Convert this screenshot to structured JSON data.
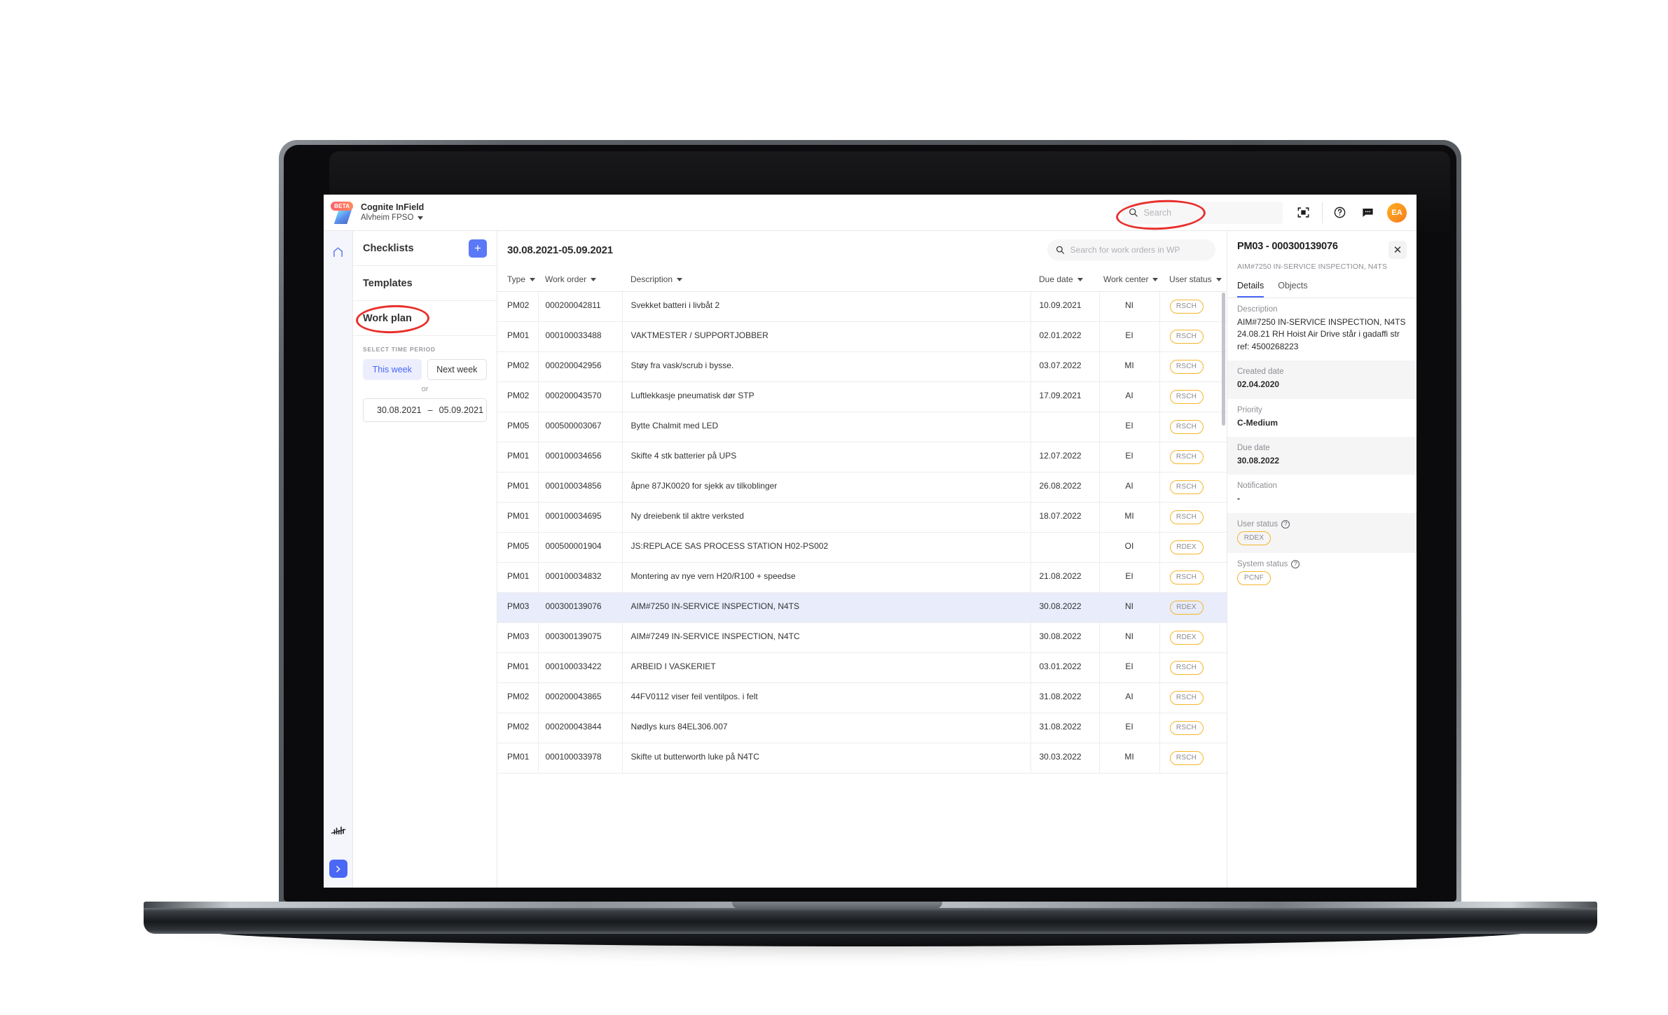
{
  "app": {
    "beta_badge": "BETA",
    "title": "Cognite InField",
    "site": "Alvheim FPSO"
  },
  "topbar": {
    "search_placeholder": "Search",
    "search_value": "",
    "scan_icon": "scan-icon",
    "help_icon": "help-icon",
    "feedback_icon": "feedback-icon",
    "avatar_initials": "EA"
  },
  "rail": {
    "home_icon": "home-icon",
    "trends_icon": "trends-icon",
    "expand_icon": "chevron-right-icon"
  },
  "sidebar": {
    "checklists_label": "Checklists",
    "add_button_label": "+",
    "templates_label": "Templates",
    "workplan_label": "Work plan",
    "time_period": {
      "title": "SELECT TIME PERIOD",
      "this_week": "This week",
      "next_week": "Next week",
      "or": "or",
      "date_from": "30.08.2021",
      "date_dash": "–",
      "date_to": "05.09.2021"
    }
  },
  "main": {
    "period_title": "30.08.2021-05.09.2021",
    "search_placeholder": "Search for work orders in WP",
    "search_value": "",
    "columns": [
      "Type",
      "Work order",
      "Description",
      "Due date",
      "Work center",
      "User status"
    ],
    "rows": [
      {
        "type": "PM02",
        "work_order": "000200042811",
        "description": "Svekket batteri i livbåt 2",
        "due_date": "10.09.2021",
        "work_center": "NI",
        "user_status": "RSCH",
        "selected": false
      },
      {
        "type": "PM01",
        "work_order": "000100033488",
        "description": "VAKTMESTER / SUPPORTJOBBER",
        "due_date": "02.01.2022",
        "work_center": "EI",
        "user_status": "RSCH",
        "selected": false
      },
      {
        "type": "PM02",
        "work_order": "000200042956",
        "description": "Støy fra vask/scrub i bysse.",
        "due_date": "03.07.2022",
        "work_center": "MI",
        "user_status": "RSCH",
        "selected": false
      },
      {
        "type": "PM02",
        "work_order": "000200043570",
        "description": "Luftlekkasje pneumatisk dør STP",
        "due_date": "17.09.2021",
        "work_center": "AI",
        "user_status": "RSCH",
        "selected": false
      },
      {
        "type": "PM05",
        "work_order": "000500003067",
        "description": "Bytte Chalmit med LED",
        "due_date": "",
        "work_center": "EI",
        "user_status": "RSCH",
        "selected": false
      },
      {
        "type": "PM01",
        "work_order": "000100034656",
        "description": "Skifte 4 stk batterier på UPS",
        "due_date": "12.07.2022",
        "work_center": "EI",
        "user_status": "RSCH",
        "selected": false
      },
      {
        "type": "PM01",
        "work_order": "000100034856",
        "description": "åpne 87JK0020 for sjekk av tilkoblinger",
        "due_date": "26.08.2022",
        "work_center": "AI",
        "user_status": "RSCH",
        "selected": false
      },
      {
        "type": "PM01",
        "work_order": "000100034695",
        "description": "Ny dreiebenk til aktre verksted",
        "due_date": "18.07.2022",
        "work_center": "MI",
        "user_status": "RSCH",
        "selected": false
      },
      {
        "type": "PM05",
        "work_order": "000500001904",
        "description": "JS:REPLACE SAS PROCESS STATION H02-PS002",
        "due_date": "",
        "work_center": "OI",
        "user_status": "RDEX",
        "selected": false
      },
      {
        "type": "PM01",
        "work_order": "000100034832",
        "description": "Montering av nye vern H20/R100 + speedse",
        "due_date": "21.08.2022",
        "work_center": "EI",
        "user_status": "RSCH",
        "selected": false
      },
      {
        "type": "PM03",
        "work_order": "000300139076",
        "description": "AIM#7250 IN-SERVICE INSPECTION, N4TS",
        "due_date": "30.08.2022",
        "work_center": "NI",
        "user_status": "RDEX",
        "selected": true
      },
      {
        "type": "PM03",
        "work_order": "000300139075",
        "description": "AIM#7249 IN-SERVICE INSPECTION, N4TC",
        "due_date": "30.08.2022",
        "work_center": "NI",
        "user_status": "RDEX",
        "selected": false
      },
      {
        "type": "PM01",
        "work_order": "000100033422",
        "description": "ARBEID I VASKERIET",
        "due_date": "03.01.2022",
        "work_center": "EI",
        "user_status": "RSCH",
        "selected": false
      },
      {
        "type": "PM02",
        "work_order": "000200043865",
        "description": "44FV0112 viser feil ventilpos. i felt",
        "due_date": "31.08.2022",
        "work_center": "AI",
        "user_status": "RSCH",
        "selected": false
      },
      {
        "type": "PM02",
        "work_order": "000200043844",
        "description": "Nødlys kurs 84EL306.007",
        "due_date": "31.08.2022",
        "work_center": "EI",
        "user_status": "RSCH",
        "selected": false
      },
      {
        "type": "PM01",
        "work_order": "000100033978",
        "description": "Skifte ut butterworth luke på N4TC",
        "due_date": "30.03.2022",
        "work_center": "MI",
        "user_status": "RSCH",
        "selected": false
      }
    ]
  },
  "details": {
    "title": "PM03 - 000300139076",
    "subtitle": "AIM#7250 IN-SERVICE INSPECTION, N4TS",
    "close_label": "✕",
    "tabs": [
      {
        "label": "Details",
        "active": true
      },
      {
        "label": "Objects",
        "active": false
      }
    ],
    "fields": [
      {
        "label": "Description",
        "value": "AIM#7250 IN-SERVICE INSPECTION, N4TS 24.08.21 RH Hoist Air Drive står i gadaffi str ref: 4500268223",
        "help": false
      },
      {
        "label": "Created date",
        "value": "02.04.2020",
        "help": false
      },
      {
        "label": "Priority",
        "value": "C-Medium",
        "help": false
      },
      {
        "label": "Due date",
        "value": "30.08.2022",
        "help": false
      },
      {
        "label": "Notification",
        "value": "-",
        "help": false
      },
      {
        "label": "User status",
        "value": "RDEX",
        "help": true,
        "pill": true
      },
      {
        "label": "System status",
        "value": "PCNF",
        "help": true,
        "pill": true
      }
    ]
  },
  "annotations": {
    "search_highlight": "red-ellipse",
    "workplan_highlight": "red-ellipse",
    "accent_color": "#4a67f5",
    "annotation_color": "#e8302c",
    "pill_border_color": "#f5b52a"
  }
}
